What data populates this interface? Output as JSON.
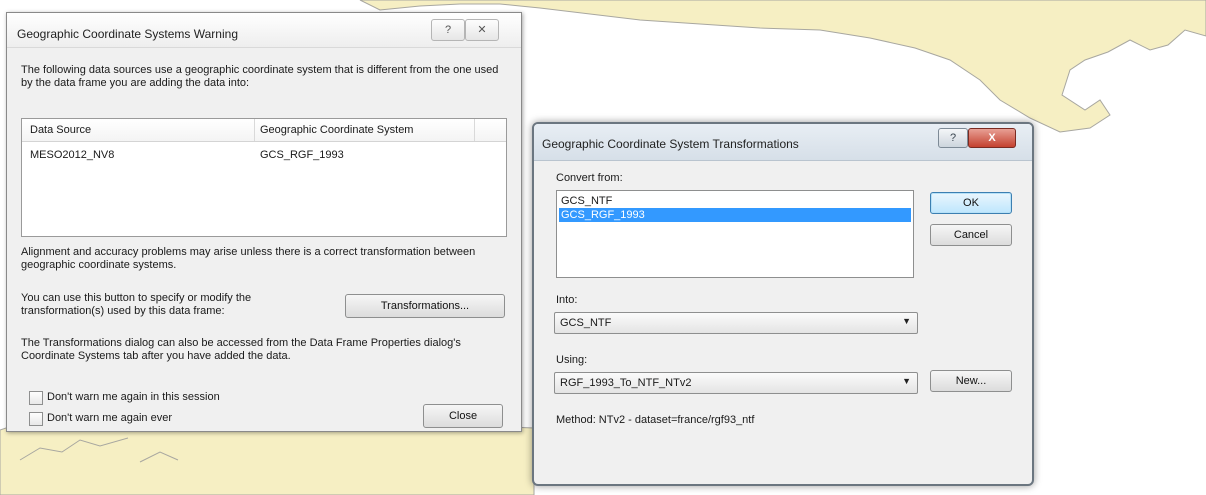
{
  "warning_dialog": {
    "title": "Geographic Coordinate Systems Warning",
    "help_glyph": "?",
    "close_glyph": "✕",
    "intro_text": "The following data sources use a geographic coordinate system that is different from the one used by the data frame you are adding the data into:",
    "table": {
      "columns": [
        "Data Source",
        "Geographic Coordinate System"
      ],
      "rows": [
        [
          "MESO2012_NV8",
          "GCS_RGF_1993"
        ]
      ]
    },
    "alignment_text": "Alignment and accuracy problems may arise unless there is a correct transformation between geographic coordinate systems.",
    "use_button_text": "You can use this button to specify or modify the transformation(s) used by this data frame:",
    "transformations_button": "Transformations...",
    "dialog_text": "The Transformations dialog can also be accessed from the Data Frame Properties dialog's Coordinate Systems tab after you have added the data.",
    "checkbox_session": "Don't warn me again in this session",
    "checkbox_ever": "Don't warn me again ever",
    "close_button": "Close"
  },
  "transform_dialog": {
    "title": "Geographic Coordinate System Transformations",
    "help_glyph": "?",
    "close_glyph": "X",
    "convert_from_label": "Convert from:",
    "convert_from_items": [
      {
        "label": "GCS_NTF",
        "selected": false
      },
      {
        "label": "GCS_RGF_1993",
        "selected": true
      }
    ],
    "into_label": "Into:",
    "into_value": "GCS_NTF",
    "using_label": "Using:",
    "using_value": "RGF_1993_To_NTF_NTv2",
    "method_text": "Method:  NTv2 - dataset=france/rgf93_ntf",
    "ok_button": "OK",
    "cancel_button": "Cancel",
    "new_button": "New..."
  },
  "colors": {
    "map_land": "#f6efc3",
    "map_coast": "#a8a7a0",
    "selection": "#3399ff"
  }
}
